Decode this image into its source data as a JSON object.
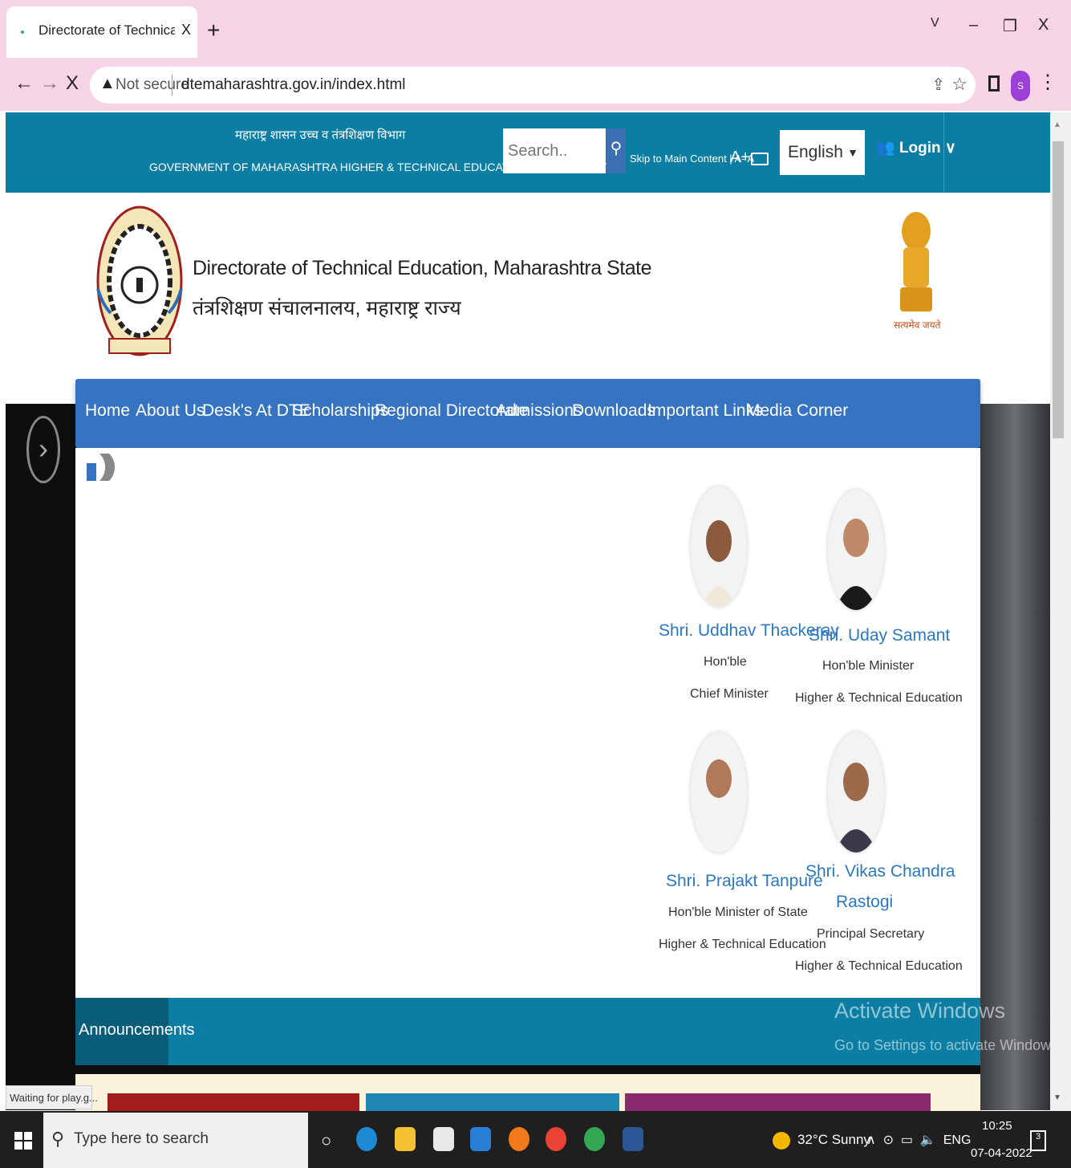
{
  "browser": {
    "tab_title": "Directorate of Technical Educatio",
    "tab_close": "X",
    "new_tab": "+",
    "win_chevron": "V",
    "win_minimize": "–",
    "win_restore": "❐",
    "win_close": "X",
    "back": "←",
    "forward": "→",
    "stop": "X",
    "security_label": "Not secure",
    "url": "dtemaharashtra.gov.in/index.html",
    "profile_initial": "S",
    "status_text": "Waiting for play.g..."
  },
  "topbar": {
    "gov_hindi": "महाराष्ट्र शासन  उच्च व तंत्रशिक्षण विभाग",
    "gov_english": "GOVERNMENT OF MAHARASHTRA  HIGHER & TECHNICAL EDUCATION DEPARTMENT",
    "search_placeholder": "Search..",
    "skip_text": "Skip to Main Content | A- A",
    "font_large": "A+",
    "language": "English",
    "login_label": "Login ∨"
  },
  "header": {
    "title_english": "Directorate of Technical Education, Maharashtra State",
    "title_hindi": "तंत्रशिक्षण संचालनालय, महाराष्ट्र राज्य",
    "emblem_motto": "सत्यमेव जयते"
  },
  "nav": {
    "items": [
      "Home",
      "About Us",
      "Desk's At DTE",
      "Scholarships",
      "Regional Directorate",
      "Admissions",
      "Downloads",
      "Important Links",
      "Media Corner"
    ]
  },
  "dignitaries": [
    {
      "name": "Shri. Uddhav Thackeray",
      "line1": "Hon'ble",
      "line2": "Chief Minister"
    },
    {
      "name": "Shri. Uday Samant",
      "line1": "Hon'ble Minister",
      "line2": "Higher & Technical Education"
    },
    {
      "name": "Shri. Prajakt Tanpure",
      "line1": "Hon'ble Minister of State",
      "line2": "Higher & Technical Education"
    },
    {
      "name_1": "Shri. Vikas Chandra",
      "name_2": "Rastogi",
      "line1": "Principal Secretary",
      "line2": "Higher & Technical Education"
    }
  ],
  "announcements": {
    "label": "Announcements"
  },
  "watermark": {
    "line1": "Activate Windows",
    "line2": "Go to Settings to activate Windows."
  },
  "taskbar": {
    "search_placeholder": "Type here to search",
    "weather": "32°C  Sunny",
    "lang": "ENG",
    "time": "10:25",
    "date": "07-04-2022",
    "notifications": "3"
  },
  "colors": {
    "topbar": "#0d7ea3",
    "nav": "#3673c0",
    "link": "#2b78c2",
    "browser_chrome": "#f6d3e5"
  }
}
